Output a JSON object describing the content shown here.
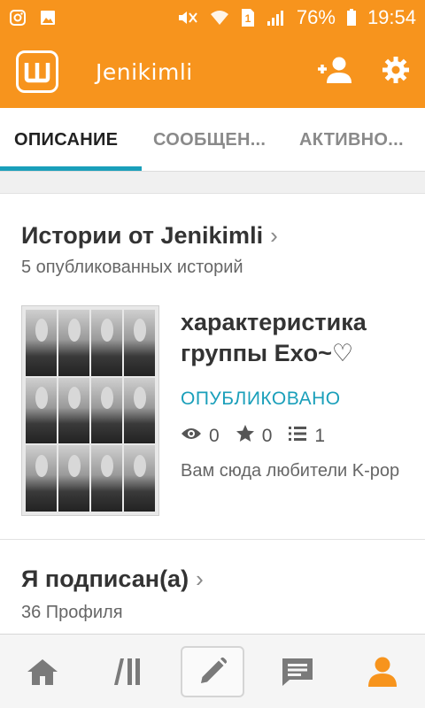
{
  "status_bar": {
    "left_icons": [
      "instagram-icon",
      "image-icon"
    ],
    "right_icons": [
      "mute-icon",
      "wifi-icon",
      "sim-icon",
      "signal-icon",
      "battery-icon"
    ],
    "sim_number": "1",
    "battery": "76%",
    "time": "19:54"
  },
  "app_bar": {
    "logo_letter": "W",
    "title": "Jenikimli",
    "actions": [
      "add-friend-icon",
      "settings-icon"
    ]
  },
  "tabs": [
    {
      "label": "ОПИСАНИЕ",
      "active": true
    },
    {
      "label": "СООБЩЕН...",
      "active": false
    },
    {
      "label": "АКТИВНО...",
      "active": false
    }
  ],
  "stories_section": {
    "title": "Истории от Jenikimli",
    "subtitle": "5 опубликованных историй",
    "story": {
      "title": "характеристика группы Exo~♡",
      "status": "ОПУБЛИКОВАНО",
      "views": "0",
      "votes": "0",
      "parts": "1",
      "description": "Вам сюда любители K-pop"
    }
  },
  "following_section": {
    "title": "Я подписан(а)",
    "subtitle": "36 Профиля"
  },
  "bottom_nav": [
    "home-icon",
    "library-icon",
    "write-icon",
    "messages-icon",
    "profile-icon"
  ],
  "colors": {
    "brand": "#f7941d",
    "accent": "#1a9fba",
    "nav_active": "#f7941d",
    "nav_inactive": "#7a7a7a"
  }
}
